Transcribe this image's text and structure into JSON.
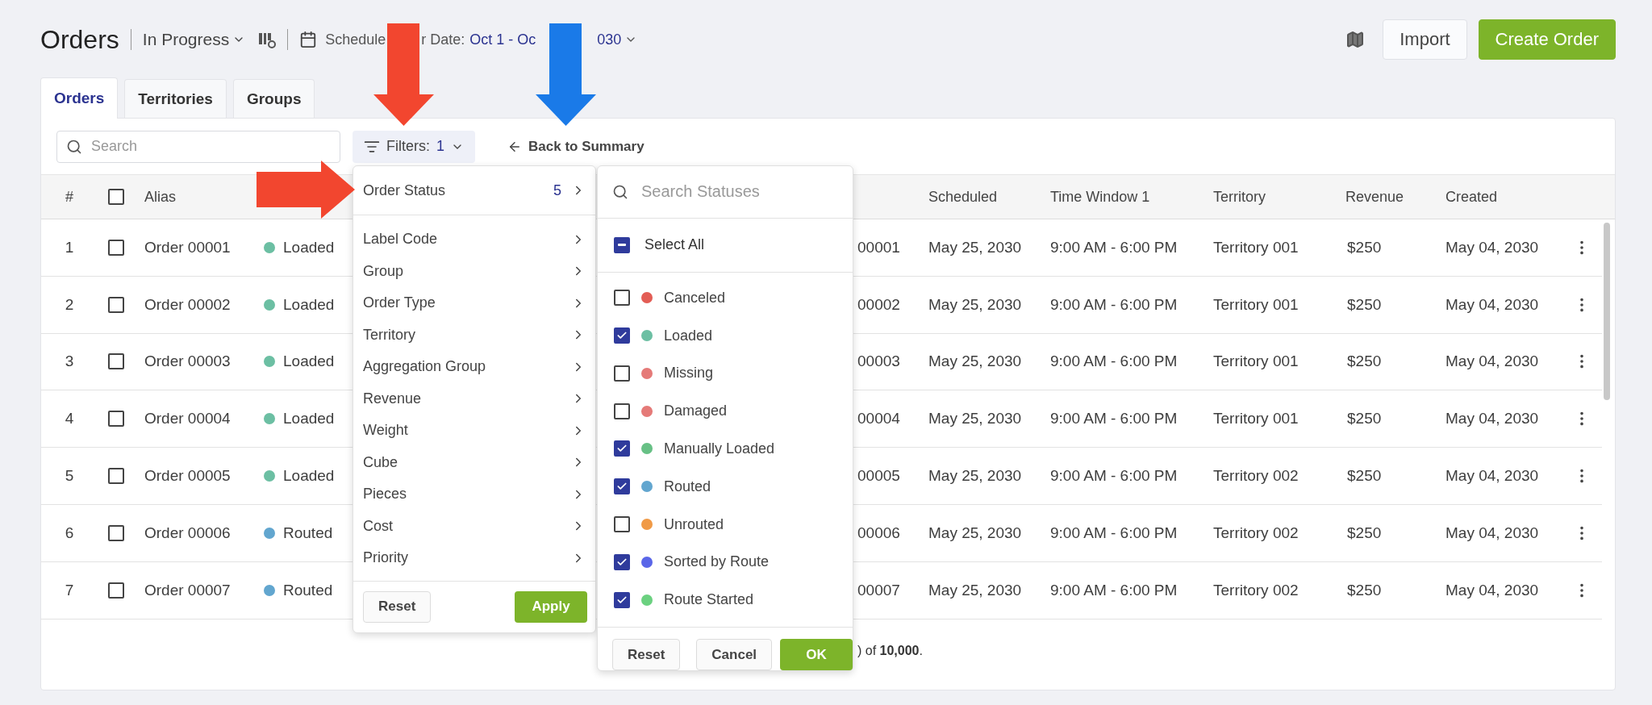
{
  "header": {
    "title": "Orders",
    "view": "In Progress",
    "date_label_parts": [
      "Schedule",
      "r Date:"
    ],
    "date_value_parts": [
      "Oct 1 - Oc",
      "030"
    ],
    "import": "Import",
    "create": "Create Order"
  },
  "callouts": [
    {
      "kind": "down",
      "color": "#f2462f"
    },
    {
      "kind": "down",
      "color": "#1a7ae8"
    },
    {
      "kind": "right",
      "color": "#f2462f"
    }
  ],
  "tabs": [
    {
      "label": "Orders",
      "selected": true
    },
    {
      "label": "Territories",
      "selected": false
    },
    {
      "label": "Groups",
      "selected": false
    }
  ],
  "toolbar": {
    "search_placeholder": "Search",
    "filters_label": "Filters:",
    "filters_count": "1",
    "back": "Back to Summary"
  },
  "table": {
    "number_header": "#",
    "select_all_checked": false,
    "columns": [
      "Alias",
      "Scheduled",
      "Time Window 1",
      "Territory",
      "Revenue",
      "Created"
    ],
    "rows": [
      {
        "number": "1",
        "checked": false,
        "alias": "Order 00001",
        "status": "Loaded",
        "color": "#6cbfa3",
        "column_5": "00001",
        "scheduled": "May 25, 2030",
        "time_window": "9:00 AM - 6:00 PM",
        "territory": "Territory 001",
        "revenue": "$250",
        "created": "May 04, 2030"
      },
      {
        "number": "2",
        "checked": false,
        "alias": "Order 00002",
        "status": "Loaded",
        "color": "#6cbfa3",
        "column_5": "00002",
        "scheduled": "May 25, 2030",
        "time_window": "9:00 AM - 6:00 PM",
        "territory": "Territory 001",
        "revenue": "$250",
        "created": "May 04, 2030"
      },
      {
        "number": "3",
        "checked": false,
        "alias": "Order 00003",
        "status": "Loaded",
        "color": "#6cbfa3",
        "column_5": "00003",
        "scheduled": "May 25, 2030",
        "time_window": "9:00 AM - 6:00 PM",
        "territory": "Territory 001",
        "revenue": "$250",
        "created": "May 04, 2030"
      },
      {
        "number": "4",
        "checked": false,
        "alias": "Order 00004",
        "status": "Loaded",
        "color": "#6cbfa3",
        "column_5": "00004",
        "scheduled": "May 25, 2030",
        "time_window": "9:00 AM - 6:00 PM",
        "territory": "Territory 001",
        "revenue": "$250",
        "created": "May 04, 2030"
      },
      {
        "number": "5",
        "checked": false,
        "alias": "Order 00005",
        "status": "Loaded",
        "color": "#6cbfa3",
        "column_5": "00005",
        "scheduled": "May 25, 2030",
        "time_window": "9:00 AM - 6:00 PM",
        "territory": "Territory 002",
        "revenue": "$250",
        "created": "May 04, 2030"
      },
      {
        "number": "6",
        "checked": false,
        "alias": "Order 00006",
        "status": "Routed",
        "color": "#62a6cf",
        "column_5": "00006",
        "scheduled": "May 25, 2030",
        "time_window": "9:00 AM - 6:00 PM",
        "territory": "Territory 002",
        "revenue": "$250",
        "created": "May 04, 2030"
      },
      {
        "number": "7",
        "checked": false,
        "alias": "Order 00007",
        "status": "Routed",
        "color": "#62a6cf",
        "column_5": "00007",
        "scheduled": "May 25, 2030",
        "time_window": "9:00 AM - 6:00 PM",
        "territory": "Territory 002",
        "revenue": "$250",
        "created": "May 04, 2030"
      }
    ],
    "footer": ") of **10,000**."
  },
  "filter_menu": {
    "active": {
      "label": "Order Status",
      "count": "5"
    },
    "items": [
      "Label Code",
      "Group",
      "Order Type",
      "Territory",
      "Aggregation Group",
      "Revenue",
      "Weight",
      "Cube",
      "Pieces",
      "Cost",
      "Priority"
    ],
    "buttons": [
      {
        "label": "Reset",
        "kind": "secondary"
      },
      {
        "label": "Apply",
        "kind": "primary"
      }
    ]
  },
  "status_panel": {
    "search_placeholder": "Search Statuses",
    "select_all": {
      "label": "Select All",
      "indeterminate": true
    },
    "statuses": [
      {
        "label": "Canceled",
        "color": "#e35d55",
        "checked": false
      },
      {
        "label": "Loaded",
        "color": "#6cbfa3",
        "checked": true
      },
      {
        "label": "Missing",
        "color": "#e57a78",
        "checked": false
      },
      {
        "label": "Damaged",
        "color": "#e57a78",
        "checked": false
      },
      {
        "label": "Manually Loaded",
        "color": "#67c085",
        "checked": true
      },
      {
        "label": "Routed",
        "color": "#62a6cf",
        "checked": true
      },
      {
        "label": "Unrouted",
        "color": "#f09a46",
        "checked": false
      },
      {
        "label": "Sorted by Route",
        "color": "#5a66e8",
        "checked": true
      },
      {
        "label": "Route Started",
        "color": "#6bd180",
        "checked": true
      }
    ],
    "buttons": [
      {
        "label": "Reset",
        "kind": "secondary"
      },
      {
        "label": "Cancel",
        "kind": "secondary"
      },
      {
        "label": "OK",
        "kind": "primary"
      }
    ]
  }
}
